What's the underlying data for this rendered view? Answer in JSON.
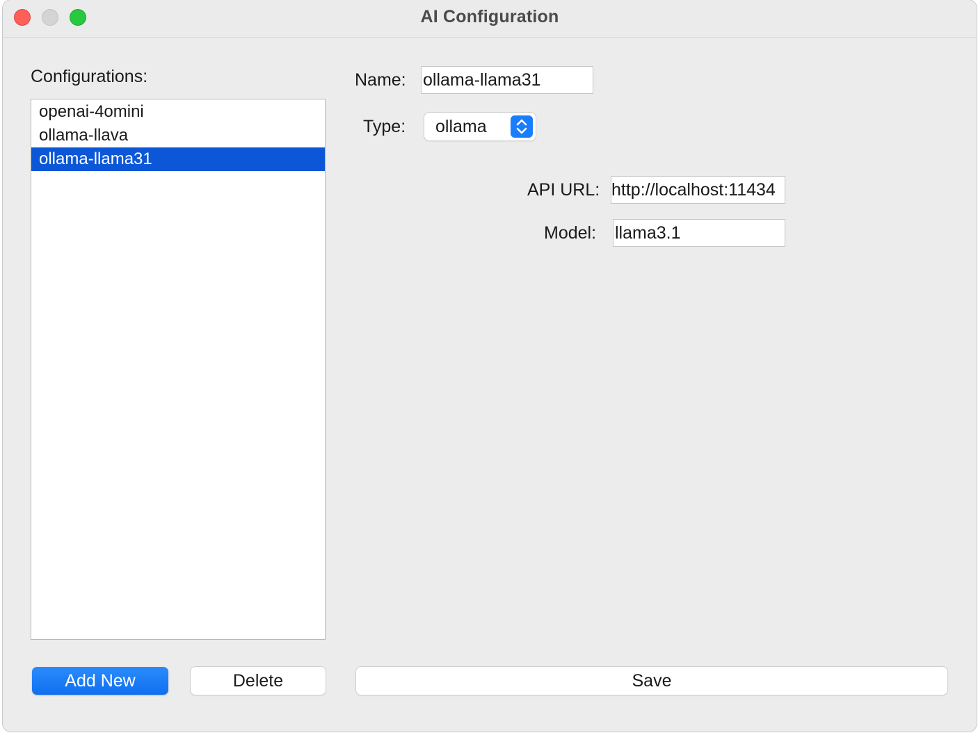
{
  "window": {
    "title": "AI Configuration"
  },
  "sidebar": {
    "label": "Configurations:",
    "items": [
      {
        "label": "openai-4omini",
        "selected": false
      },
      {
        "label": "ollama-llava",
        "selected": false
      },
      {
        "label": "ollama-llama31",
        "selected": true
      }
    ],
    "add_button": "Add New",
    "delete_button": "Delete"
  },
  "form": {
    "name_label": "Name:",
    "name_value": "ollama-llama31",
    "type_label": "Type:",
    "type_value": "ollama",
    "api_url_label": "API URL:",
    "api_url_value": "http://localhost:11434",
    "model_label": "Model:",
    "model_value": "llama3.1",
    "save_button": "Save"
  },
  "colors": {
    "selection": "#0b57d8",
    "accent": "#1a7dfb",
    "close": "#fe5f57",
    "zoom": "#28c840"
  }
}
